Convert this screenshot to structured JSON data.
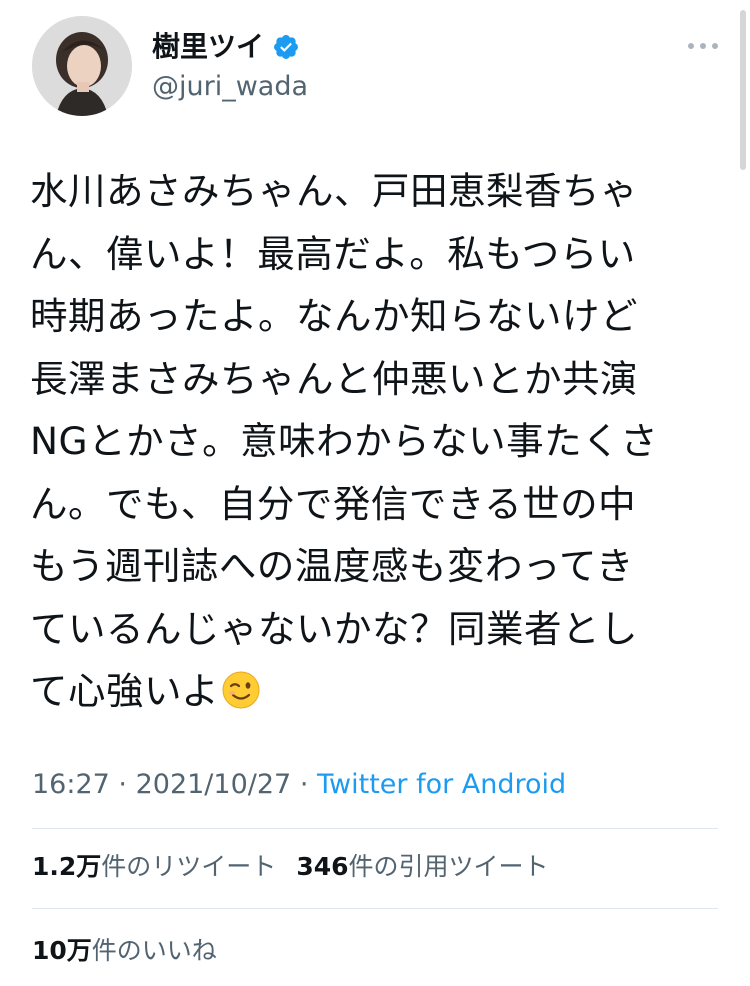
{
  "tweet": {
    "author": {
      "display_name": "樹里ツイ",
      "handle": "@juri_wada",
      "verified": true,
      "avatar_icon": "profile-photo"
    },
    "more_icon": "more-options-icon",
    "text": "水川あさみちゃん、戸田恵梨香ちゃ\nん、偉いよ！最高だよ。私もつらい\n時期あったよ。なんか知らないけど\n長澤まさみちゃんと仲悪いとか共演\nNGとかさ。意味わからない事たくさ\nん。でも、自分で発信できる世の中\nもう週刊誌への温度感も変わってき\nているんじゃないかな？同業者とし\nて心強いよ",
    "emoji": "winking-face",
    "time": "16:27",
    "separator": "·",
    "date": "2021/10/27",
    "source": "Twitter for Android"
  },
  "stats": {
    "retweets_count": "1.2万",
    "retweets_label": "件のリツイート",
    "quotes_count": "346",
    "quotes_label": "件の引用ツイート",
    "likes_count": "10万",
    "likes_label": "件のいいね"
  },
  "colors": {
    "text": "#0f1419",
    "secondary": "#536471",
    "link": "#1d9bf0",
    "verified": "#1d9bf0",
    "divider": "#e1e6ea"
  }
}
